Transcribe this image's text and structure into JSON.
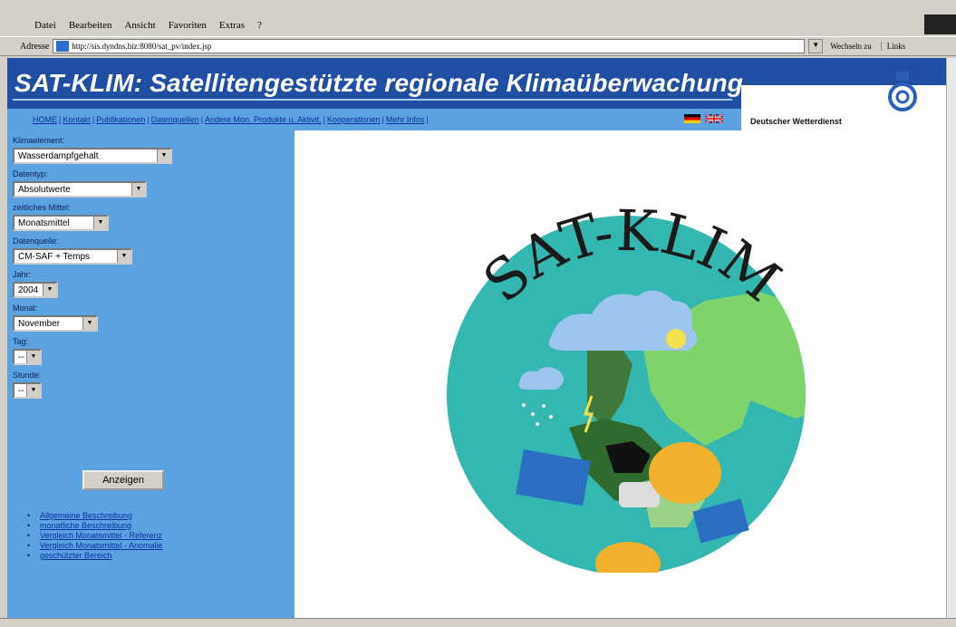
{
  "browser": {
    "menu": [
      "Datei",
      "Bearbeiten",
      "Ansicht",
      "Favoriten",
      "Extras",
      "?"
    ],
    "address_label": "Adresse",
    "address_value": "http://sis.dyndns.biz:8080/sat_pv/index.jsp",
    "go_label": "Wechseln zu",
    "links_label": "Links"
  },
  "header": {
    "title": "SAT-KLIM: Satellitengestützte regionale Klimaüberwachung",
    "org": "Deutscher Wetterdienst"
  },
  "nav": {
    "items": [
      "HOME",
      "Kontakt",
      "Publikationen",
      "Datenquellen",
      "Andere Mon. Produkte u. Aktivit.",
      "Kooperationen",
      "Mehr Infos"
    ]
  },
  "form": {
    "klimaelement_label": "Klimaelement:",
    "klimaelement_value": "Wasserdampfgehalt",
    "datentyp_label": "Datentyp:",
    "datentyp_value": "Absolutwerte",
    "mittel_label": "zeitliches Mittel:",
    "mittel_value": "Monatsmittel",
    "quelle_label": "Datenquelle:",
    "quelle_value": "CM-SAF + Temps",
    "jahr_label": "Jahr:",
    "jahr_value": "2004",
    "monat_label": "Monat:",
    "monat_value": "November",
    "tag_label": "Tag:",
    "tag_value": "--",
    "stunde_label": "Stunde:",
    "stunde_value": "--",
    "submit_label": "Anzeigen"
  },
  "links": [
    "Allgemeine Beschreibung",
    "monatliche Beschreibung",
    "Vergleich Monatsmittel - Referenz",
    "Vergleich Monatsmittel - Anomalie",
    "geschützter Bereich"
  ],
  "logo": {
    "text": "SAT-KLIM"
  },
  "colors": {
    "header_blue": "#1f4ea3",
    "sidebar_blue": "#5aa2e0",
    "link_blue": "#0b2fa0",
    "logo_sea": "#34b7b0"
  },
  "icons": [
    "ie-page-icon",
    "dwd-logo-icon",
    "flag-de-icon",
    "flag-uk-icon"
  ]
}
